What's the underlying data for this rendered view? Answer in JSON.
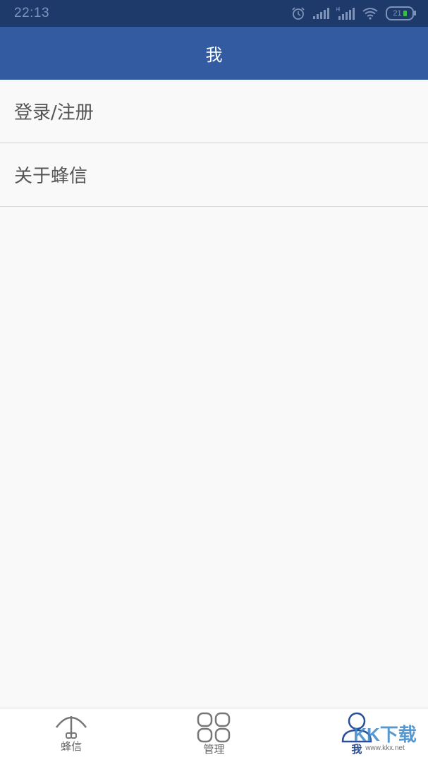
{
  "status_bar": {
    "time": "22:13",
    "battery": "21",
    "icons": [
      "alarm-icon",
      "signal-icon",
      "hd-signal-icon",
      "wifi-icon",
      "battery-icon"
    ]
  },
  "header": {
    "title": "我"
  },
  "menu": {
    "items": [
      {
        "label": "登录/注册"
      },
      {
        "label": "关于蜂信"
      }
    ]
  },
  "tab_bar": {
    "tabs": [
      {
        "label": "蜂信",
        "icon": "umbrella-icon",
        "active": false
      },
      {
        "label": "管理",
        "icon": "grid-icon",
        "active": false
      },
      {
        "label": "我",
        "icon": "person-icon",
        "active": true
      }
    ]
  },
  "watermark": {
    "logo_text": "KK下载",
    "url": "www.kkx.net"
  },
  "colors": {
    "header": "#325ba1",
    "status_bar": "#1e3a6b",
    "active_tab": "#2a4f9a"
  }
}
